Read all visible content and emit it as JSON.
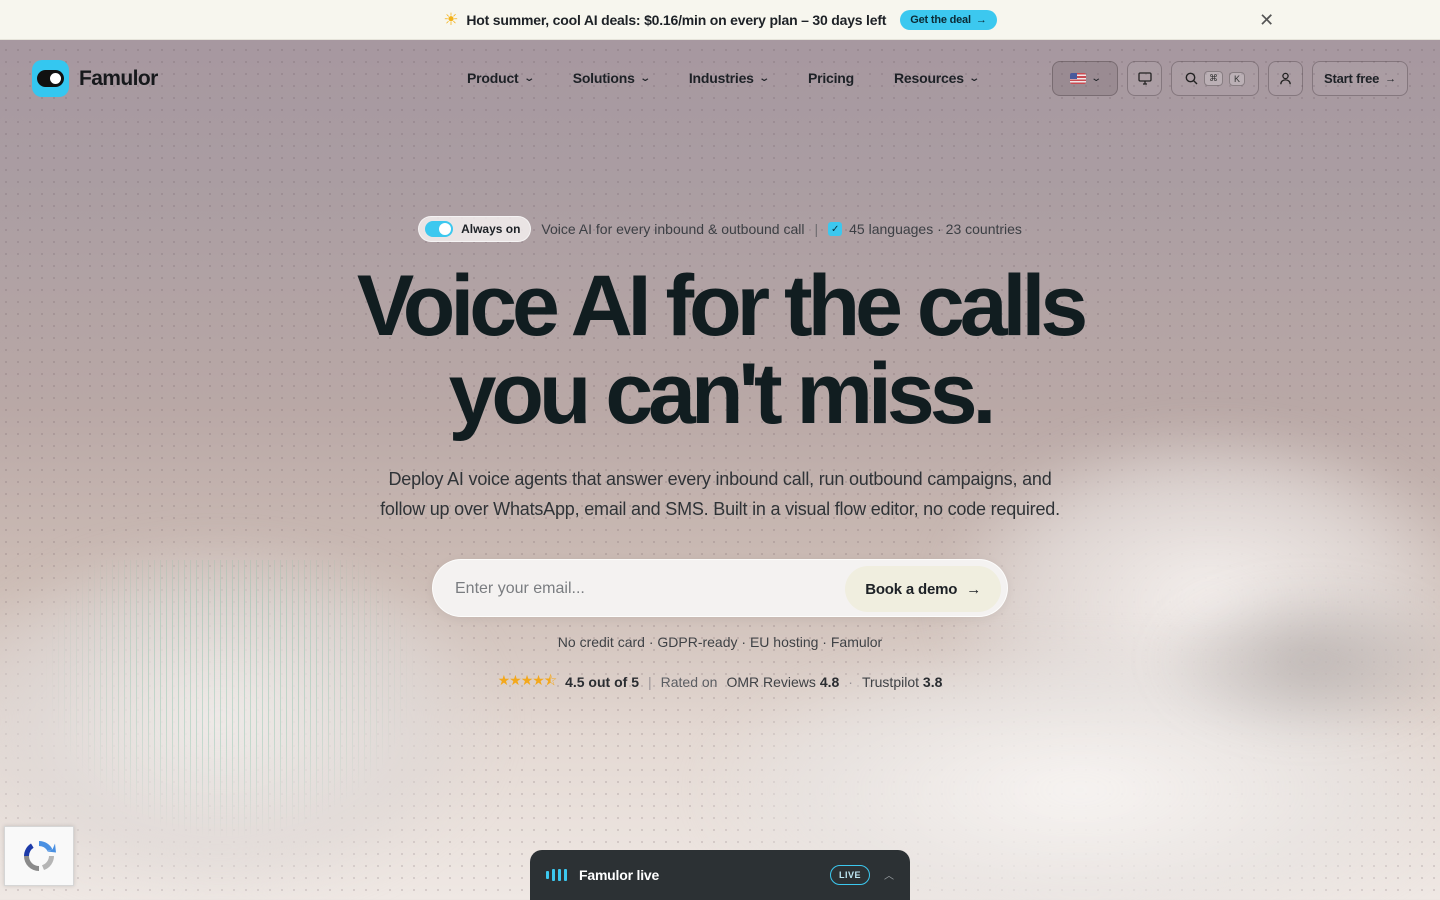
{
  "promo": {
    "icon": "sun-icon",
    "text": "Hot summer, cool AI deals: $0.16/min on every plan – 30 days left",
    "cta": "Get the deal",
    "close": "close-icon"
  },
  "brand": {
    "name": "Famulor",
    "accent": "#34c7f0"
  },
  "nav": {
    "items": [
      {
        "label": "Product",
        "dropdown": true
      },
      {
        "label": "Solutions",
        "dropdown": true
      },
      {
        "label": "Industries",
        "dropdown": true
      },
      {
        "label": "Pricing",
        "dropdown": false
      },
      {
        "label": "Resources",
        "dropdown": true
      }
    ],
    "search_shortcut": [
      "⌘",
      "K"
    ],
    "start_label": "Start free"
  },
  "hero": {
    "badge": "Always on",
    "tagline": "Voice AI for every inbound & outbound call",
    "languages": "45 languages · 23 countries",
    "title_line1": "Voice AI for the calls",
    "title_line2": "you can't miss.",
    "subtitle": "Deploy AI voice agents that answer every inbound call, run outbound campaigns, and follow up over WhatsApp, email and SMS. Built in a visual flow editor, no code required.",
    "email_placeholder": "Enter your email...",
    "cta": "Book a demo",
    "fine_print": "No credit card · GDPR-ready · EU hosting · Famulor"
  },
  "ratings": {
    "stars": 4.5,
    "score_text": "4.5 out of 5",
    "rated_on": "Rated on",
    "omr_label": "OMR Reviews",
    "omr_score": "4.8",
    "dot": "·",
    "trustpilot_label": "Trustpilot",
    "trustpilot_score": "3.8"
  },
  "live_bar": {
    "title": "Famulor live",
    "badge": "LIVE"
  }
}
